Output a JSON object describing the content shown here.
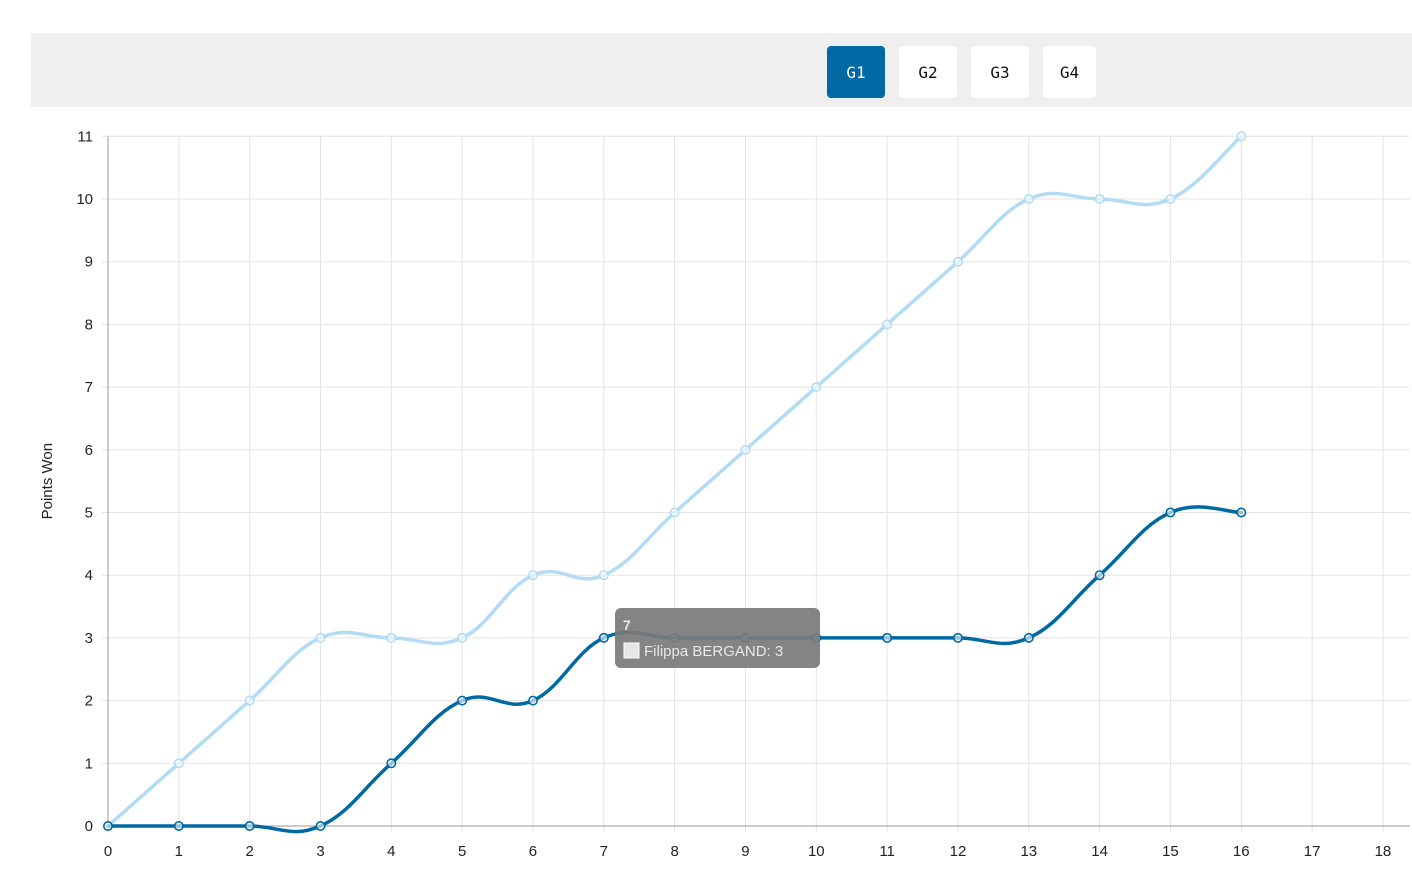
{
  "tabs": [
    {
      "label": "G1",
      "active": true
    },
    {
      "label": "G2",
      "active": false
    },
    {
      "label": "G3",
      "active": false
    },
    {
      "label": "G4",
      "active": false
    }
  ],
  "colors": {
    "accent": "#0069a3",
    "series_dark": "#0069a3",
    "series_light": "#b3dbf5",
    "tooltip_bg": "#7a7a7a"
  },
  "chart_data": {
    "type": "line",
    "title": "",
    "xlabel": "",
    "ylabel": "Points Won",
    "xlim": [
      0,
      18
    ],
    "ylim": [
      0,
      11
    ],
    "grid": true,
    "x_ticks": [
      0,
      1,
      2,
      3,
      4,
      5,
      6,
      7,
      8,
      9,
      10,
      11,
      12,
      13,
      14,
      15,
      16,
      17,
      18
    ],
    "y_ticks": [
      0,
      1,
      2,
      3,
      4,
      5,
      6,
      7,
      8,
      9,
      10,
      11
    ],
    "series": [
      {
        "name": "",
        "color": "#b3dbf5",
        "x": [
          0,
          1,
          2,
          3,
          4,
          5,
          6,
          7,
          8,
          9,
          10,
          11,
          12,
          13,
          14,
          15,
          16
        ],
        "y": [
          0,
          1,
          2,
          3,
          3,
          3,
          4,
          4,
          5,
          6,
          7,
          8,
          9,
          10,
          10,
          10,
          11
        ]
      },
      {
        "name": "Filippa BERGAND",
        "color": "#0069a3",
        "x": [
          0,
          1,
          2,
          3,
          4,
          5,
          6,
          7,
          8,
          9,
          10,
          11,
          12,
          13,
          14,
          15,
          16
        ],
        "y": [
          0,
          0,
          0,
          0,
          1,
          2,
          2,
          3,
          3,
          3,
          3,
          3,
          3,
          3,
          4,
          5,
          5
        ]
      }
    ],
    "tooltip": {
      "title": "7",
      "label": "Filippa BERGAND: 3"
    }
  }
}
